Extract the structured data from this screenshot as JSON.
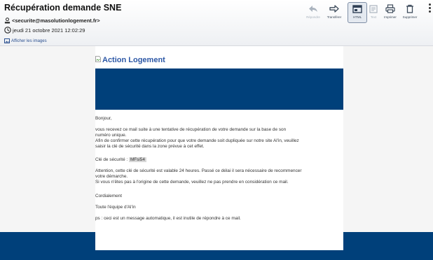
{
  "header": {
    "subject": "Récupération demande SNE",
    "sender": "<securite@masolutionlogement.fr>",
    "date": "jeudi 21 octobre 2021 12:02:29",
    "show_images": "Afficher les images"
  },
  "toolbar": {
    "reply": "Répondre",
    "forward": "Transférer",
    "html": "HTML",
    "text": "Text",
    "print": "Imprimer",
    "delete": "Supprimer"
  },
  "body": {
    "logo_alt": "Action Logement",
    "greeting": "Bonjour,",
    "p1_line1": "vous recevez ce mail suite à une tentative de récupération de votre demande sur la base de son",
    "p1_line2": "numéro unique.",
    "p1_line3": "Afin de confirmer cette récupération pour que votre demande soit dupliquée sur notre site Al'in, veuillez",
    "p1_line4": "saisir la clé de sécurité dans la zone prévue à cet effet.",
    "key_label": "Clé de sécurité : ",
    "key_value": "MFsi54",
    "p3_line1": "Attention, cette clé de sécurité est valable 24 heures. Passé ce délai il sera nécessaire de recommencer",
    "p3_line2": "votre démarche.",
    "p3_line3": "Si vous n'êtes pas à l'origine de cette demande, veuillez ne pas prendre en considération ce mail.",
    "closing": "Cordialement",
    "team": "Toute l'équipe d'Al'in",
    "ps": "ps : ceci est un message automatique, il est inutile de répondre à ce mail."
  },
  "colors": {
    "brand_blue": "#00407a",
    "link_blue": "#2c57a6"
  }
}
